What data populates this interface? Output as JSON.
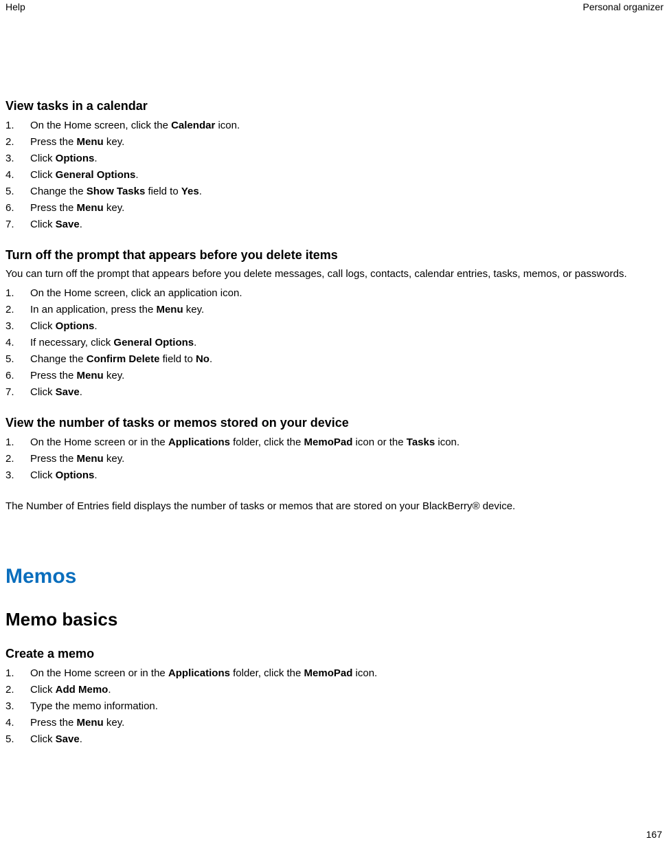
{
  "header": {
    "left": "Help",
    "right": "Personal organizer"
  },
  "footer": {
    "page": "167"
  },
  "section1": {
    "title": "View tasks in a calendar",
    "steps": [
      [
        {
          "t": "On the Home screen, click the "
        },
        {
          "b": "Calendar"
        },
        {
          "t": " icon."
        }
      ],
      [
        {
          "t": "Press the "
        },
        {
          "b": "Menu"
        },
        {
          "t": " key."
        }
      ],
      [
        {
          "t": "Click "
        },
        {
          "b": "Options"
        },
        {
          "t": "."
        }
      ],
      [
        {
          "t": "Click "
        },
        {
          "b": "General Options"
        },
        {
          "t": "."
        }
      ],
      [
        {
          "t": "Change the "
        },
        {
          "b": "Show Tasks"
        },
        {
          "t": " field to "
        },
        {
          "b": "Yes"
        },
        {
          "t": "."
        }
      ],
      [
        {
          "t": "Press the "
        },
        {
          "b": "Menu"
        },
        {
          "t": " key."
        }
      ],
      [
        {
          "t": "Click "
        },
        {
          "b": "Save"
        },
        {
          "t": "."
        }
      ]
    ]
  },
  "section2": {
    "title": "Turn off the prompt that appears before you delete items",
    "intro": "You can turn off the prompt that appears before you delete messages, call logs, contacts, calendar entries, tasks, memos, or passwords.",
    "steps": [
      [
        {
          "t": "On the Home screen, click an application icon."
        }
      ],
      [
        {
          "t": "In an application, press the "
        },
        {
          "b": "Menu"
        },
        {
          "t": " key."
        }
      ],
      [
        {
          "t": "Click "
        },
        {
          "b": "Options"
        },
        {
          "t": "."
        }
      ],
      [
        {
          "t": "If necessary, click "
        },
        {
          "b": "General Options"
        },
        {
          "t": "."
        }
      ],
      [
        {
          "t": "Change the "
        },
        {
          "b": "Confirm Delete"
        },
        {
          "t": " field to "
        },
        {
          "b": "No"
        },
        {
          "t": "."
        }
      ],
      [
        {
          "t": "Press the "
        },
        {
          "b": "Menu"
        },
        {
          "t": " key."
        }
      ],
      [
        {
          "t": "Click "
        },
        {
          "b": "Save"
        },
        {
          "t": "."
        }
      ]
    ]
  },
  "section3": {
    "title": "View the number of tasks or memos stored on your device",
    "steps": [
      [
        {
          "t": "On the Home screen or in the "
        },
        {
          "b": "Applications"
        },
        {
          "t": " folder, click the "
        },
        {
          "b": "MemoPad"
        },
        {
          "t": " icon or the "
        },
        {
          "b": "Tasks"
        },
        {
          "t": " icon."
        }
      ],
      [
        {
          "t": "Press the "
        },
        {
          "b": "Menu"
        },
        {
          "t": " key."
        }
      ],
      [
        {
          "t": "Click "
        },
        {
          "b": "Options"
        },
        {
          "t": "."
        }
      ]
    ],
    "outro": "The Number of Entries field displays the number of tasks or memos that are stored on your BlackBerry® device."
  },
  "chapter": {
    "title": "Memos"
  },
  "subchapter": {
    "title": "Memo basics"
  },
  "section4": {
    "title": "Create a memo",
    "steps": [
      [
        {
          "t": "On the Home screen or in the "
        },
        {
          "b": "Applications"
        },
        {
          "t": " folder, click the "
        },
        {
          "b": "MemoPad"
        },
        {
          "t": " icon."
        }
      ],
      [
        {
          "t": "Click "
        },
        {
          "b": "Add Memo"
        },
        {
          "t": "."
        }
      ],
      [
        {
          "t": "Type the memo information."
        }
      ],
      [
        {
          "t": "Press the "
        },
        {
          "b": "Menu"
        },
        {
          "t": " key."
        }
      ],
      [
        {
          "t": "Click "
        },
        {
          "b": "Save"
        },
        {
          "t": "."
        }
      ]
    ]
  }
}
